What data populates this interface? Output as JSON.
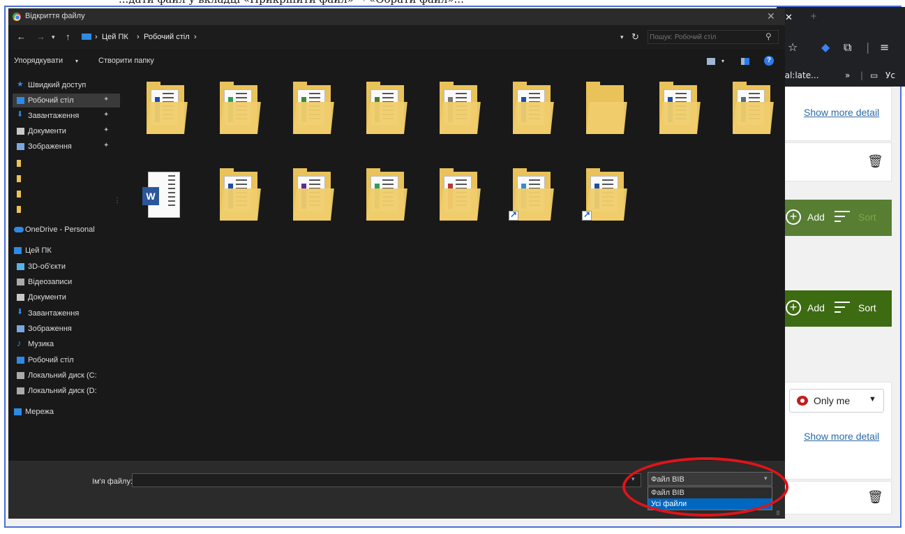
{
  "doc_fragment": "...дати файл у вкладці «Прикріпити файл» → «Обрати файл»...",
  "dialog": {
    "title": "Відкриття файлу",
    "breadcrumb": [
      "Цей ПК",
      "Робочий стіл"
    ],
    "search_placeholder": "Пошук: Робочий стіл",
    "toolbar": {
      "organize": "Упорядкувати",
      "new_folder": "Створити папку"
    },
    "nav_items": [
      {
        "label": "Швидкий доступ",
        "icon": "star-icon",
        "color": "#2e8ae6"
      },
      {
        "label": "Робочий стіл",
        "icon": "desktop-icon",
        "color": "#2e8ae6",
        "selected": true,
        "pinned": true
      },
      {
        "label": "Завантаження",
        "icon": "download-icon",
        "color": "#2e8ae6",
        "pinned": true
      },
      {
        "label": "Документи",
        "icon": "documents-icon",
        "color": "#c8c8c8",
        "pinned": true
      },
      {
        "label": "Зображення",
        "icon": "pictures-icon",
        "color": "#7aa7e0",
        "pinned": true
      },
      {
        "label": "",
        "icon": "folder-icon",
        "color": "#e9c25a"
      },
      {
        "label": "",
        "icon": "folder-icon",
        "color": "#e9c25a"
      },
      {
        "label": "",
        "icon": "folder-icon",
        "color": "#e9c25a"
      },
      {
        "label": "",
        "icon": "folder-icon",
        "color": "#e9c25a"
      },
      {
        "label": "OneDrive - Personal",
        "icon": "cloud-icon",
        "color": "#2e8ae6"
      },
      {
        "label": "Цей ПК",
        "icon": "computer-icon",
        "color": "#2e8ae6"
      },
      {
        "label": "3D-об'єкти",
        "icon": "cube-icon",
        "color": "#5ab0e8"
      },
      {
        "label": "Відеозаписи",
        "icon": "video-icon",
        "color": "#aaaaaa"
      },
      {
        "label": "Документи",
        "icon": "documents-icon",
        "color": "#c8c8c8"
      },
      {
        "label": "Завантаження",
        "icon": "download-icon",
        "color": "#2e8ae6"
      },
      {
        "label": "Зображення",
        "icon": "pictures-icon",
        "color": "#7aa7e0"
      },
      {
        "label": "Музика",
        "icon": "music-icon",
        "color": "#2e8ae6"
      },
      {
        "label": "Робочий стіл",
        "icon": "desktop-icon",
        "color": "#2e8ae6"
      },
      {
        "label": "Локальний диск (C:",
        "icon": "drive-icon",
        "color": "#aaaaaa"
      },
      {
        "label": "Локальний диск (D:",
        "icon": "drive-icon",
        "color": "#aaaaaa"
      },
      {
        "label": "Мережа",
        "icon": "network-icon",
        "color": "#2e8ae6"
      }
    ],
    "files_row1": [
      {
        "type": "folder-doc",
        "accent": "#1f4ea7"
      },
      {
        "type": "folder-doc",
        "accent": "#2e9e5a"
      },
      {
        "type": "folder-doc",
        "accent": "#3a8a3a"
      },
      {
        "type": "folder-doc",
        "accent": "#4a7d32"
      },
      {
        "type": "folder-doc",
        "accent": "#777777"
      },
      {
        "type": "folder-doc",
        "accent": "#1f4ea7"
      },
      {
        "type": "folder-empty",
        "accent": ""
      },
      {
        "type": "folder-doc",
        "accent": "#1f4ea7"
      },
      {
        "type": "folder-doc",
        "accent": "#5a6a7a"
      }
    ],
    "files_row2": [
      {
        "type": "word",
        "accent": "#2b579a"
      },
      {
        "type": "folder-doc",
        "accent": "#1f4ea7"
      },
      {
        "type": "folder-doc",
        "accent": "#5b2a9a"
      },
      {
        "type": "folder-doc",
        "accent": "#2e9e5a"
      },
      {
        "type": "folder-doc",
        "accent": "#b43a3a"
      },
      {
        "type": "folder-doc-shortcut",
        "accent": "#3a8ad0"
      },
      {
        "type": "folder-doc-shortcut",
        "accent": "#1f4ea7"
      }
    ],
    "filename_label": "Ім'я файлу:",
    "filename_value": "",
    "filetype_selected": "Файл BIB",
    "filetype_options": [
      "Файл BIB",
      "Усі файли"
    ],
    "filetype_highlighted": "Усі файли"
  },
  "right_panel": {
    "show_more": "Show more detail",
    "add": "Add",
    "sort": "Sort",
    "only_me": "Only me",
    "bookmark_partial": "nal:late...",
    "bookmark_folder_partial": "Ус",
    "accent_green": "#3d6b12",
    "link_color": "#2b6aa7"
  }
}
